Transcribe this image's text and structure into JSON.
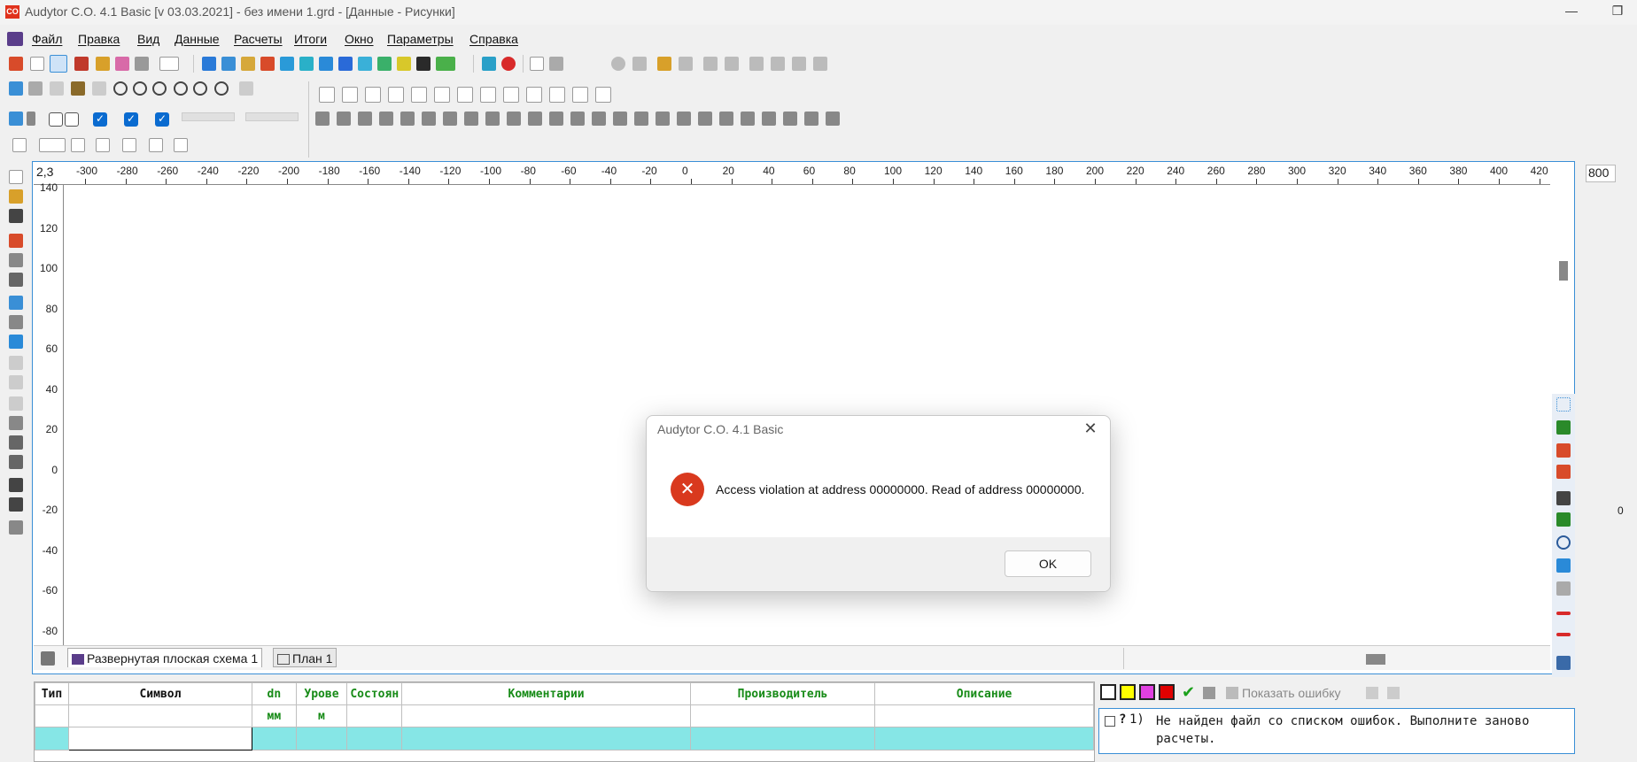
{
  "window": {
    "title": "Audytor C.O. 4.1 Basic [v 03.03.2021] - без имени 1.grd - [Данные - Рисунки]",
    "app_icon_text": "CO",
    "minimize_glyph": "—",
    "restore_glyph": "❐"
  },
  "menu": {
    "items": [
      "Файл",
      "Правка",
      "Вид",
      "Данные",
      "Расчеты",
      "Итоги",
      "Окно",
      "Параметры",
      "Справка"
    ]
  },
  "ruler": {
    "corner_value": "2,3",
    "top_ticks": [
      "-300",
      "-280",
      "-260",
      "-240",
      "-220",
      "-200",
      "-180",
      "-160",
      "-140",
      "-120",
      "-100",
      "-80",
      "-60",
      "-40",
      "-20",
      "0",
      "20",
      "40",
      "60",
      "80",
      "100",
      "120",
      "140",
      "160",
      "180",
      "200",
      "220",
      "240",
      "260",
      "280",
      "300",
      "320",
      "340",
      "360",
      "380",
      "400",
      "420"
    ],
    "left_ticks": [
      "140",
      "120",
      "100",
      "80",
      "60",
      "40",
      "20",
      "0",
      "-20",
      "-40",
      "-60",
      "-80"
    ]
  },
  "right_panel": {
    "value": "800",
    "zero_label": "0"
  },
  "tabs": [
    {
      "label": "Развернутая плоская схема 1"
    },
    {
      "label": "План 1"
    }
  ],
  "table": {
    "headers_row1": [
      "Тип",
      "Символ",
      "dn",
      "Урове",
      "Состоян",
      "Комментарии",
      "Производитель",
      "Описание"
    ],
    "headers_row2": [
      "",
      "",
      "мм",
      "м",
      "",
      "",
      "",
      ""
    ]
  },
  "errors_panel": {
    "show_error_label": "Показать ошибку",
    "swatches": [
      "#ffffff",
      "#ffff00",
      "#e040e0",
      "#e00000"
    ],
    "items": [
      {
        "number": "1)",
        "text": "Не найден файл со списком ошибок. Выполните заново расчеты."
      }
    ]
  },
  "dialog": {
    "title": "Audytor C.O. 4.1 Basic",
    "message": "Access violation at address 00000000. Read of address 00000000.",
    "ok_label": "OK",
    "icon": "error-icon",
    "icon_glyph": "✕",
    "close_glyph": "✕"
  },
  "colors": {
    "accent": "#3a8fd6",
    "error_red": "#d9391e",
    "table_selected": "#86e6e6",
    "header_green": "#178b17"
  }
}
